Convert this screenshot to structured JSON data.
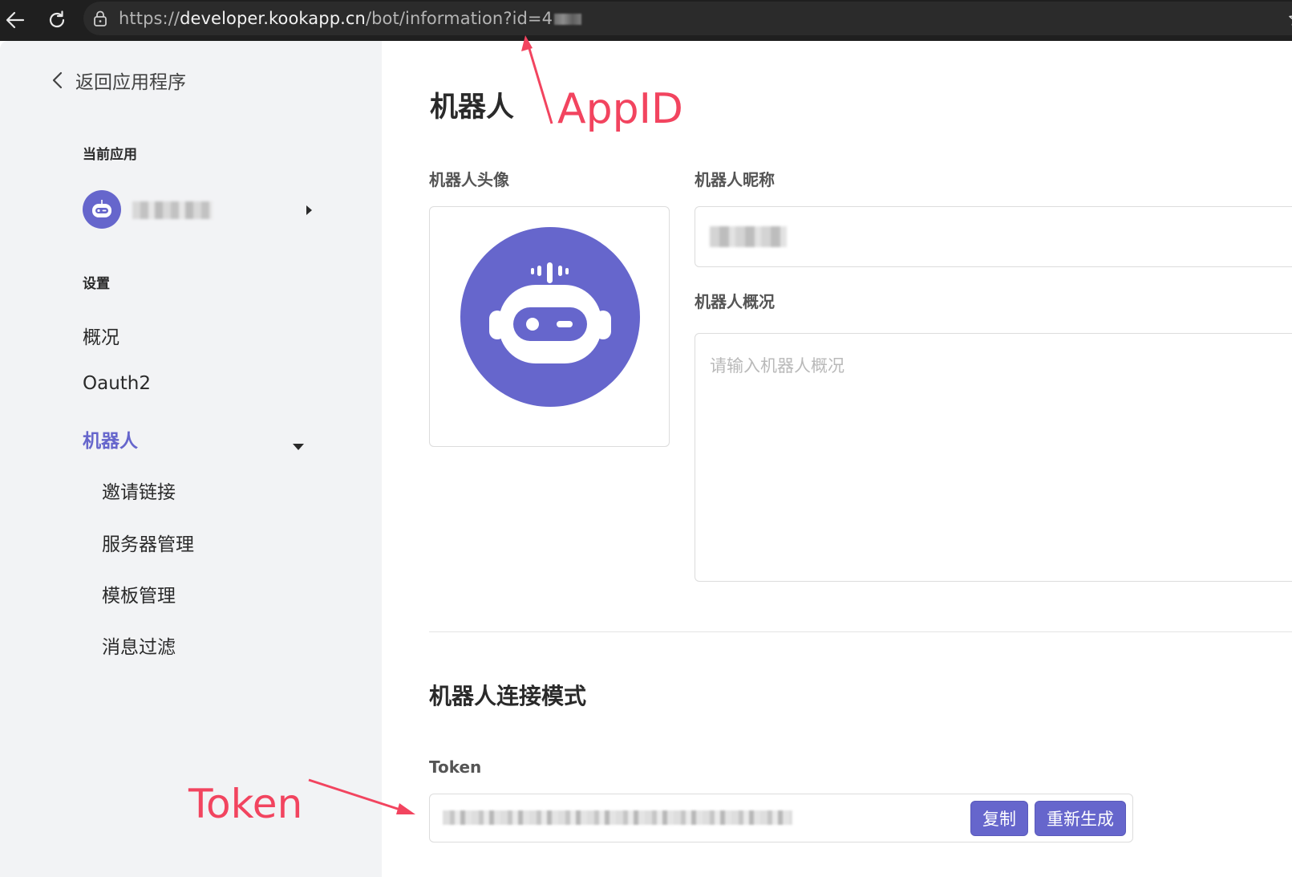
{
  "browser": {
    "url_prefix": "https://",
    "url_host": "developer.kookapp.cn",
    "url_path": "/bot/information?id=4"
  },
  "sidebar": {
    "back_label": "返回应用程序",
    "current_app_label": "当前应用",
    "settings_label": "设置",
    "items": [
      {
        "label": "概况"
      },
      {
        "label": "Oauth2"
      },
      {
        "label": "机器人"
      },
      {
        "label": "邀请链接"
      },
      {
        "label": "服务器管理"
      },
      {
        "label": "模板管理"
      },
      {
        "label": "消息过滤"
      }
    ]
  },
  "main": {
    "title": "机器人",
    "avatar_label": "机器人头像",
    "nickname_label": "机器人昵称",
    "summary_label": "机器人概况",
    "summary_placeholder": "请输入机器人概况",
    "connection_title": "机器人连接模式",
    "token_label": "Token",
    "copy_button": "复制",
    "regenerate_button": "重新生成"
  },
  "annotations": {
    "appid": "AppID",
    "token": "Token"
  },
  "colors": {
    "accent": "#6666cc",
    "annotation": "#f2445f",
    "sidebar_bg": "#f2f3f5",
    "browser_bg": "#1f1f1f"
  },
  "icons": [
    "back-arrow-icon",
    "reload-icon",
    "lock-icon",
    "star-icon",
    "chevron-left-icon",
    "robot-icon",
    "caret-right-icon",
    "caret-down-icon"
  ]
}
